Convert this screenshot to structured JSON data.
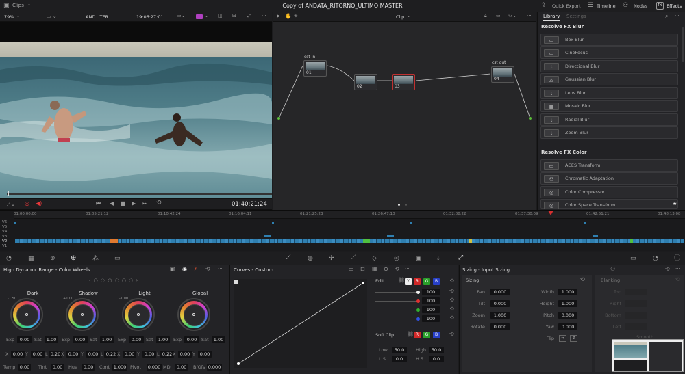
{
  "topbar": {
    "left_label": "Clips",
    "title": "Copy of ANDATA_RITORNO_ULTIMO MASTER",
    "quick_export": "Quick Export",
    "timeline": "Timeline",
    "nodes": "Nodes",
    "effects": "Effects"
  },
  "viewer": {
    "zoom": "79%",
    "clip_name": "AND...TER",
    "timecode": "19:06:27:01",
    "playhead_tc": "01:40:21:24"
  },
  "nodeeditor": {
    "mode_label": "Clip",
    "nodes": [
      {
        "label": "cst in",
        "num": "01"
      },
      {
        "label": "",
        "num": "02"
      },
      {
        "label": "",
        "num": "03"
      },
      {
        "label": "cst out",
        "num": "04"
      }
    ]
  },
  "library": {
    "tab_library": "Library",
    "tab_settings": "Settings",
    "sections": [
      {
        "title": "Resolve FX Blur",
        "items": [
          "Box Blur",
          "CineFocus",
          "Directional Blur",
          "Gaussian Blur",
          "Lens Blur",
          "Mosaic Blur",
          "Radial Blur",
          "Zoom Blur"
        ]
      },
      {
        "title": "Resolve FX Color",
        "items": [
          "ACES Transform",
          "Chromatic Adaptation",
          "Color Compressor",
          "Color Space Transform"
        ]
      }
    ]
  },
  "ruler": [
    "01:00:00:00",
    "01:05:21:12",
    "01:10:42:24",
    "01:16:04:11",
    "01:21:25:23",
    "01:26:47:10",
    "01:32:08:22",
    "01:37:30:09",
    "01:42:51:21",
    "01:48:13:08"
  ],
  "tracks": [
    "V6",
    "V5",
    "V4",
    "V3",
    "V2",
    "V1"
  ],
  "wheels": {
    "title": "High Dynamic Range - Color Wheels",
    "items": [
      {
        "name": "Dark",
        "stop": "-1.50",
        "exp": "0.00",
        "sat": "1.00",
        "x": "0.00",
        "y": "0.00",
        "l": "0.20"
      },
      {
        "name": "Shadow",
        "stop": "+1.00",
        "exp": "0.00",
        "sat": "1.00",
        "x": "0.00",
        "y": "0.00",
        "l": "0.22"
      },
      {
        "name": "Light",
        "stop": "-1.00",
        "exp": "0.00",
        "sat": "1.00",
        "x": "0.00",
        "y": "0.00",
        "l": "0.22"
      },
      {
        "name": "Global",
        "stop": "",
        "exp": "0.00",
        "sat": "1.00",
        "x": "0.00",
        "y": "0.00",
        "l": ""
      }
    ],
    "bottom": [
      {
        "k": "Temp",
        "v": "0.00"
      },
      {
        "k": "Tint",
        "v": "0.00"
      },
      {
        "k": "Hue",
        "v": "0.00"
      },
      {
        "k": "Cont",
        "v": "1.000"
      },
      {
        "k": "Pivot",
        "v": "0.000"
      },
      {
        "k": "MD",
        "v": "0.00"
      },
      {
        "k": "B/Ofs",
        "v": "0.000"
      }
    ],
    "exp_label": "Exp",
    "sat_label": "Sat",
    "x_label": "X",
    "y_label": "Y",
    "l_label": "L"
  },
  "curves": {
    "title": "Curves - Custom",
    "edit": "Edit",
    "y": "Y",
    "r": "R",
    "g": "G",
    "b": "B",
    "values": [
      "100",
      "100",
      "100",
      "100"
    ],
    "soft_clip": "Soft Clip",
    "low_label": "Low",
    "low": "50.0",
    "high_label": "High",
    "high": "50.0",
    "ls": "L.S.",
    "hs": "H.S.",
    "ls_v": "0.0",
    "hs_v": "0.0"
  },
  "sizing": {
    "title": "Sizing - Input Sizing",
    "section": "Sizing",
    "pan": "Pan",
    "pan_v": "0.000",
    "tilt": "Tilt",
    "tilt_v": "0.000",
    "zoom": "Zoom",
    "zoom_v": "1.000",
    "rotate": "Rotate",
    "rotate_v": "0.000",
    "width": "Width",
    "width_v": "1.000",
    "height": "Height",
    "height_v": "1.000",
    "pitch": "Pitch",
    "pitch_v": "0.000",
    "yaw": "Yaw",
    "yaw_v": "0.000",
    "flip": "Flip",
    "blanking": "Blanking",
    "top": "Top",
    "right": "Right",
    "bottom": "Bottom",
    "left": "Left",
    "smooth": "Smooth"
  },
  "colors": {
    "accent": "#e5373a",
    "playhead": "#d63030",
    "clip": "#2f7fb0"
  }
}
